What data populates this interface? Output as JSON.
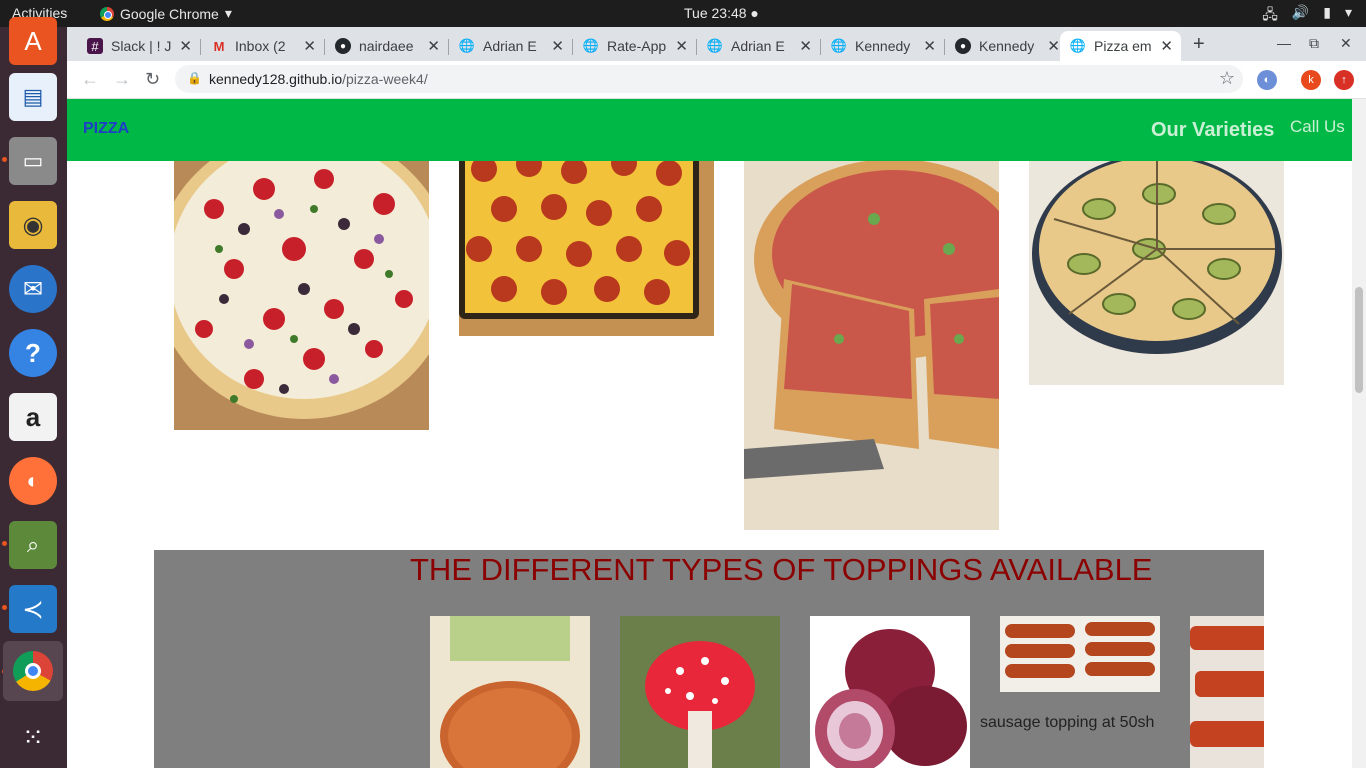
{
  "topbar": {
    "activities": "Activities",
    "app_name": "Google Chrome",
    "clock": "Tue 23:48"
  },
  "dock": {
    "items": [
      "ubuntu-software-icon",
      "writer-icon",
      "files-icon",
      "rhythmbox-icon",
      "thunderbird-icon",
      "help-icon",
      "amazon-icon",
      "firefox-icon",
      "image-viewer-icon",
      "vscode-icon",
      "chrome-icon",
      "app-grid-icon"
    ]
  },
  "tabs": [
    {
      "label": "Slack | ! J",
      "icon": "slack-icon"
    },
    {
      "label": "Inbox (2",
      "icon": "gmail-icon"
    },
    {
      "label": "nairdaee",
      "icon": "github-icon"
    },
    {
      "label": "Adrian E",
      "icon": "globe-icon"
    },
    {
      "label": "Rate-App",
      "icon": "globe-icon"
    },
    {
      "label": "Adrian E",
      "icon": "globe-icon"
    },
    {
      "label": "Kennedy",
      "icon": "globe-icon"
    },
    {
      "label": "Kennedy",
      "icon": "github-icon"
    },
    {
      "label": "Pizza em",
      "icon": "globe-icon"
    }
  ],
  "address_bar": {
    "host": "kennedy128.github.io",
    "path": "/pizza-week4/"
  },
  "profile_initial": "k",
  "site": {
    "brand": "PIZZA",
    "nav_varieties": "Our Varieties",
    "nav_call": "Call Us",
    "toppings_title": "THE DIFFERENT TYPES OF TOPPINGS AVAILABLE",
    "sausage_caption": "sausage topping at 50sh"
  },
  "colors": {
    "site_nav": "#00b846",
    "brand_text": "#1f3ec8",
    "toppings_bg": "#7f7f7f",
    "toppings_title": "#8b0000"
  }
}
